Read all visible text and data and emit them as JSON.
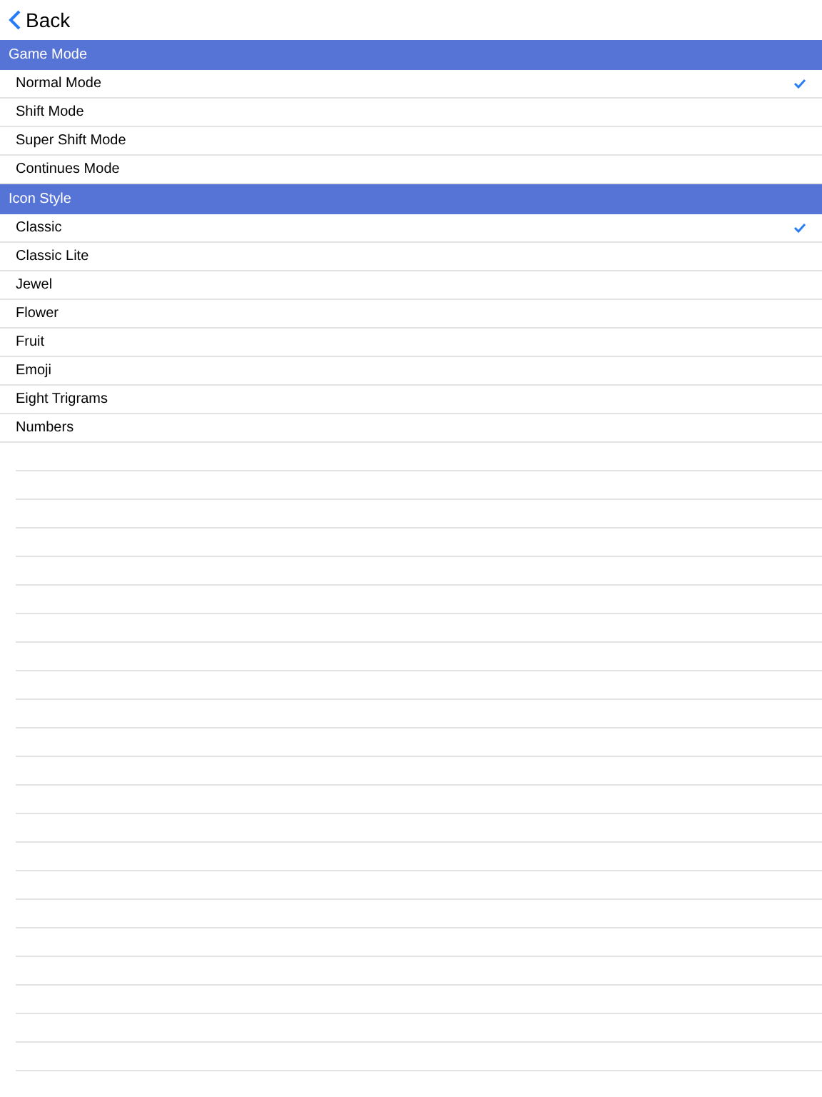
{
  "nav": {
    "back": "Back"
  },
  "sections": [
    {
      "title": "Game Mode",
      "items": [
        {
          "label": "Normal Mode",
          "selected": true
        },
        {
          "label": "Shift Mode",
          "selected": false
        },
        {
          "label": "Super Shift Mode",
          "selected": false
        },
        {
          "label": "Continues Mode",
          "selected": false
        }
      ]
    },
    {
      "title": "Icon Style",
      "items": [
        {
          "label": "Classic",
          "selected": true
        },
        {
          "label": "Classic Lite",
          "selected": false
        },
        {
          "label": "Jewel",
          "selected": false
        },
        {
          "label": "Flower",
          "selected": false
        },
        {
          "label": "Fruit",
          "selected": false
        },
        {
          "label": "Emoji",
          "selected": false
        },
        {
          "label": "Eight Trigrams",
          "selected": false
        },
        {
          "label": "Numbers",
          "selected": false
        }
      ]
    }
  ]
}
